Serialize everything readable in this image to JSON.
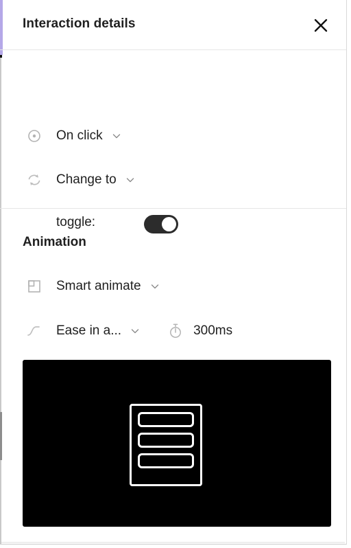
{
  "panel": {
    "accent_color": "#b5a8e8",
    "background": "#ffffff"
  },
  "header": {
    "title": "Interaction details",
    "close_icon": "close-icon"
  },
  "trigger_section": {
    "trigger": {
      "icon": "click-target-icon",
      "label": "On click",
      "chevron": "chevron-down-icon"
    },
    "action": {
      "icon": "change-to-swap-icon",
      "label": "Change to",
      "chevron": "chevron-down-icon"
    },
    "destination": {
      "label": "toggle:",
      "switch_state": "on",
      "switch_color": "#2c2c2c",
      "knob_color": "#ffffff"
    }
  },
  "animation_section": {
    "title": "Animation",
    "animation_type": {
      "icon": "smart-animate-icon",
      "label": "Smart animate",
      "chevron": "chevron-down-icon"
    },
    "easing": {
      "icon": "easing-curve-icon",
      "label": "Ease in a...",
      "chevron": "chevron-down-icon"
    },
    "duration": {
      "icon": "stopwatch-icon",
      "value": "300ms"
    },
    "preview": {
      "background": "#000000",
      "wireframe_color": "#ffffff",
      "bars": 3
    }
  }
}
